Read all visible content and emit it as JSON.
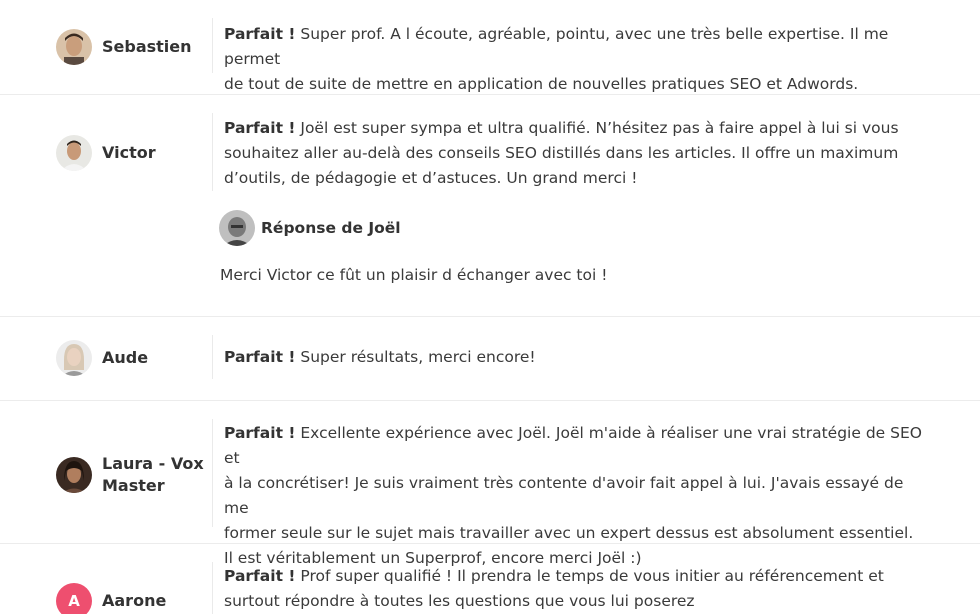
{
  "reviews": [
    {
      "author": "Sebastien",
      "rating": "Parfait !",
      "lines": [
        " Super prof. A l écoute, agréable, pointu, avec une très belle expertise. Il me permet",
        "de tout de suite de mettre en application de nouvelles pratiques SEO et Adwords."
      ]
    },
    {
      "author": "Victor",
      "rating": "Parfait !",
      "lines": [
        " Joël est super sympa et ultra qualifié. N’hésitez pas à faire appel à lui si vous",
        "souhaitez aller au-delà des conseils SEO distillés dans les articles. Il offre un maximum",
        "d’outils, de pédagogie et d’astuces. Un grand merci !"
      ],
      "reply": {
        "title": "Réponse de Joël",
        "text": "Merci Victor ce fût un plaisir d échanger avec toi !"
      }
    },
    {
      "author": "Aude",
      "rating": "Parfait !",
      "lines": [
        " Super résultats, merci encore!"
      ]
    },
    {
      "author_lines": [
        "Laura - Vox",
        "Master"
      ],
      "rating": "Parfait !",
      "lines": [
        " Excellente expérience avec Joël. Joël m'aide à réaliser une vrai stratégie de SEO et",
        "à la concrétiser! Je suis vraiment très contente d'avoir fait appel à lui. J'avais essayé de me",
        "former seule sur le sujet mais travailler avec un expert dessus est absolument essentiel.",
        "Il est véritablement un Superprof, encore merci Joël :)"
      ]
    },
    {
      "author": "Aarone",
      "avatar_letter": "A",
      "rating": "Parfait !",
      "lines": [
        " Prof super qualifié ! Il prendra le temps de vous initier au référencement et",
        "surtout répondre à toutes les questions que vous lui poserez"
      ]
    }
  ],
  "colors": {
    "accent_avatar": "#ee4f6f",
    "text": "#3a3a3a",
    "divider": "#eaeaea"
  }
}
